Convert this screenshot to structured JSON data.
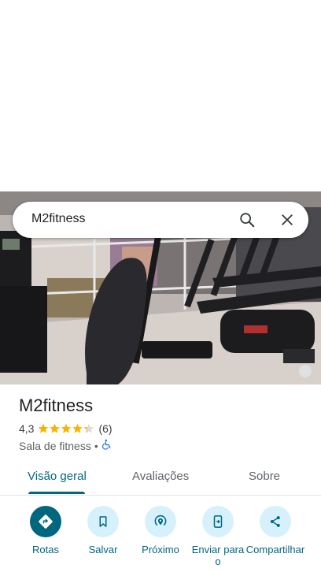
{
  "search": {
    "query": "M2fitness"
  },
  "place": {
    "name": "M2fitness",
    "rating": "4,3",
    "rating_value": 4.3,
    "reviews": "(6)",
    "category": "Sala de fitness",
    "separator": "•"
  },
  "tabs": [
    {
      "label": "Visão geral",
      "active": true
    },
    {
      "label": "Avaliações",
      "active": false
    },
    {
      "label": "Sobre",
      "active": false
    }
  ],
  "actions": [
    {
      "label": "Rotas",
      "icon": "directions-icon"
    },
    {
      "label": "Salvar",
      "icon": "bookmark-icon"
    },
    {
      "label": "Próximo",
      "icon": "nearby-icon"
    },
    {
      "label": "Enviar para o",
      "icon": "send-to-phone-icon"
    },
    {
      "label": "Compartilhar",
      "icon": "share-icon"
    }
  ],
  "colors": {
    "accent": "#00677f",
    "accent_light": "#d6f1fb",
    "star": "#f4b400",
    "text": "#202124",
    "muted": "#5f6368"
  }
}
